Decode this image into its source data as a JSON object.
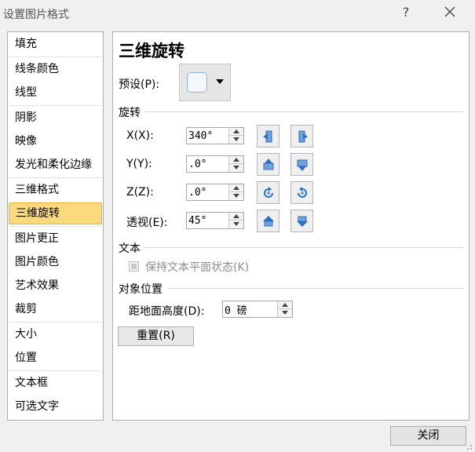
{
  "window": {
    "title": "设置图片格式",
    "help_glyph": "?"
  },
  "nav": {
    "items": [
      {
        "label": "填充"
      },
      {
        "label": "线条颜色"
      },
      {
        "label": "线型"
      },
      {
        "label": "阴影"
      },
      {
        "label": "映像"
      },
      {
        "label": "发光和柔化边缘"
      },
      {
        "label": "三维格式"
      },
      {
        "label": "三维旋转",
        "selected": true
      },
      {
        "label": "图片更正"
      },
      {
        "label": "图片颜色"
      },
      {
        "label": "艺术效果"
      },
      {
        "label": "裁剪"
      },
      {
        "label": "大小"
      },
      {
        "label": "位置"
      },
      {
        "label": "文本框"
      },
      {
        "label": "可选文字"
      }
    ]
  },
  "pane": {
    "title": "三维旋转",
    "preset_label": "预设(P):",
    "rotation_section": "旋转",
    "x": {
      "label": "X(X):",
      "value": "340°"
    },
    "y": {
      "label": "Y(Y):",
      "value": ".0°"
    },
    "z": {
      "label": "Z(Z):",
      "value": ".0°"
    },
    "perspective": {
      "label": "透视(E):",
      "value": "45°"
    },
    "text_section": "文本",
    "keep_text_flat_label": "保持文本平面状态(K)",
    "object_position_section": "对象位置",
    "distance_label": "距地面高度(D):",
    "distance_value": "0 磅",
    "reset_label": "重置(R)"
  },
  "footer": {
    "close_label": "关闭"
  },
  "colors": {
    "selected_bg": "#fbd97e",
    "selected_border": "#e3b23a",
    "rotate_icon_blue": "#2f6fc2"
  },
  "icons": {
    "x_left": "rotate-left-icon",
    "x_right": "rotate-right-icon",
    "y_up": "rotate-up-icon",
    "y_down": "rotate-down-icon",
    "z_ccw": "rotate-counterclockwise-icon",
    "z_cw": "rotate-clockwise-icon",
    "persp_narrow": "perspective-decrease-icon",
    "persp_widen": "perspective-increase-icon"
  }
}
